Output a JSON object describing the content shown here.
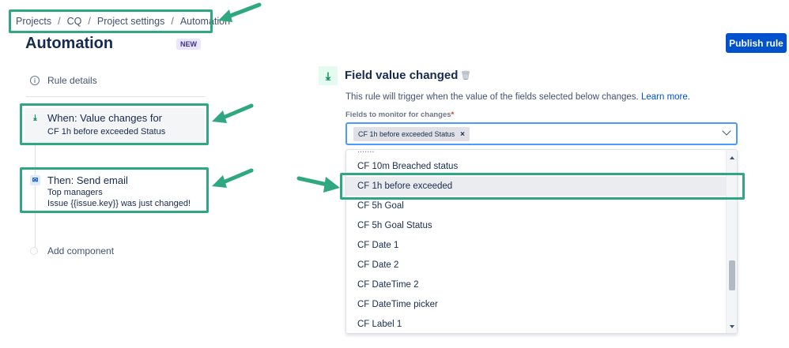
{
  "breadcrumb": [
    "Projects",
    "CQ",
    "Project settings",
    "Automation"
  ],
  "page": {
    "title": "Automation",
    "badge": "NEW",
    "publish_label": "Publish rule"
  },
  "sidebar": {
    "rule_details": "Rule details",
    "when": {
      "title": "When: Value changes for",
      "subtitle": "CF 1h before exceeded Status"
    },
    "then": {
      "title": "Then: Send email",
      "line1": "Top managers",
      "line2": "Issue {{issue.key}} was just changed!"
    },
    "add_component": "Add component"
  },
  "panel": {
    "title": "Field value changed",
    "description": "This rule will trigger when the value of the fields selected below changes.",
    "learn_more": "Learn more.",
    "field_label": "Fields to monitor for changes",
    "required_mark": "*",
    "selected_tag": "CF 1h before exceeded Status",
    "options": [
      "CF 10m Breached status",
      "CF 1h before exceeded",
      "CF 5h Goal",
      "CF 5h Goal Status",
      "CF Date 1",
      "CF Date 2",
      "CF DateTime 2",
      "CF DateTime picker",
      "CF Label 1"
    ],
    "highlighted_option": "CF 1h before exceeded"
  },
  "colors": {
    "annotation": "#2fa882",
    "primary": "#0052cc",
    "focus": "#4c9aff"
  }
}
